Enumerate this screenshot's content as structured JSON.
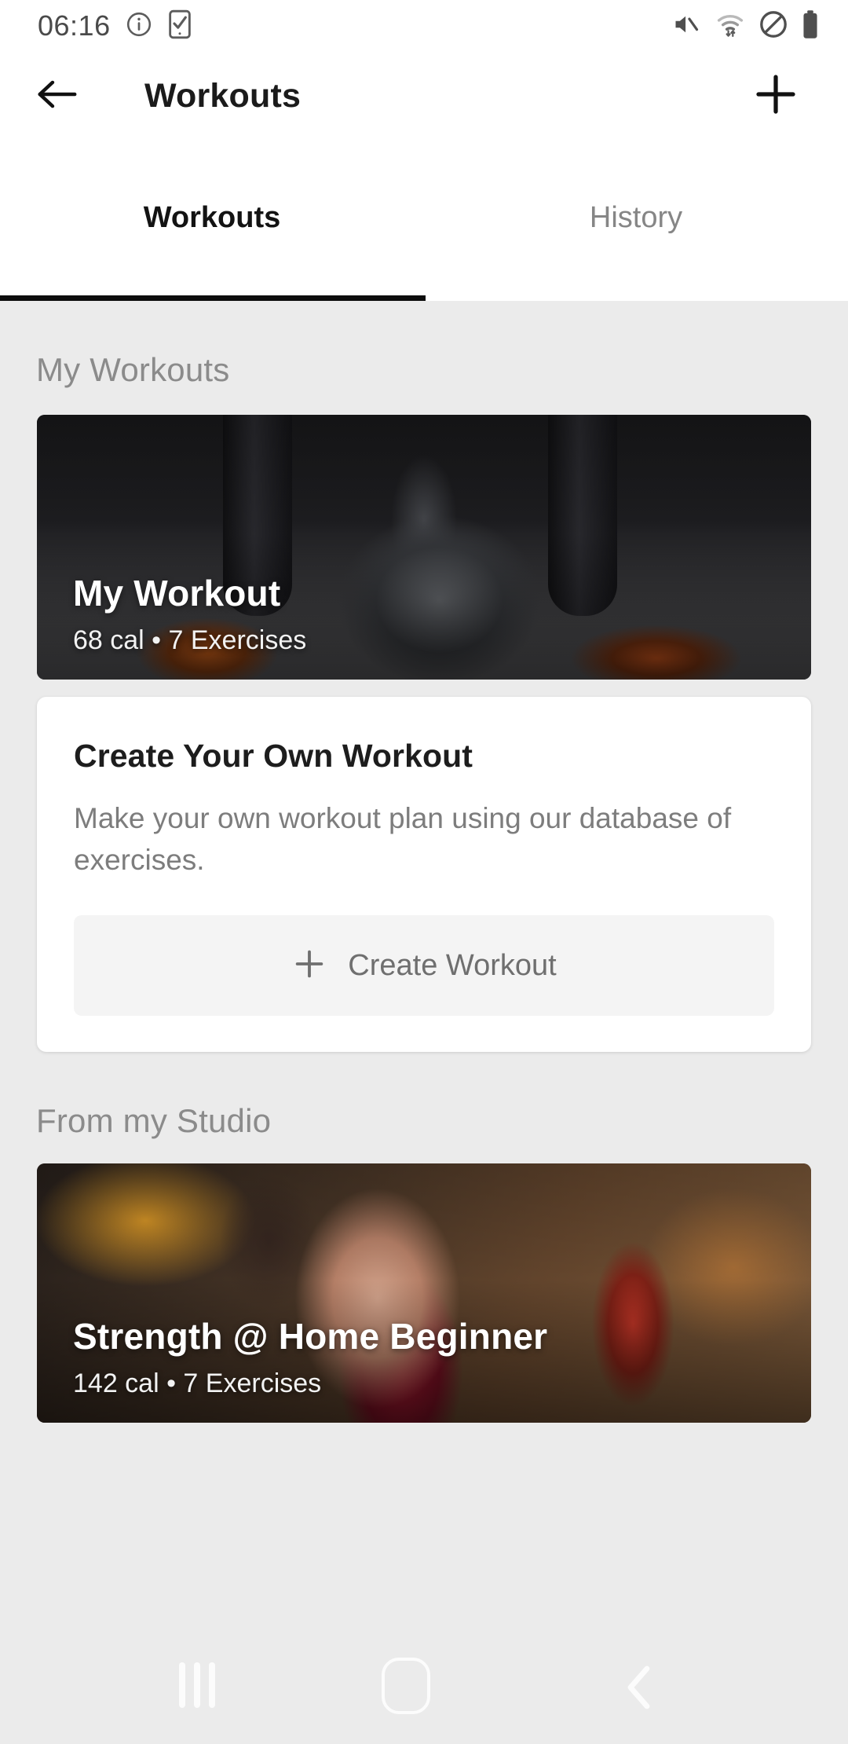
{
  "statusbar": {
    "time": "06:16",
    "left_icons": [
      "info-icon",
      "phone-check-icon"
    ],
    "right_icons": [
      "volume-mute-icon",
      "wifi-icon",
      "do-not-disturb-icon",
      "battery-full-icon"
    ]
  },
  "appbar": {
    "back_icon": "arrow-back-icon",
    "title": "Workouts",
    "add_icon": "plus-icon"
  },
  "tabs": [
    {
      "label": "Workouts",
      "active": true
    },
    {
      "label": "History",
      "active": false
    }
  ],
  "sections": [
    {
      "title": "My Workouts",
      "workout_card": {
        "title": "My Workout",
        "subtitle": "68 cal • 7 Exercises",
        "calories": "68 cal",
        "exercises": "7 Exercises"
      },
      "create_card": {
        "title": "Create Your Own Workout",
        "description": "Make your own workout plan using our database of exercises.",
        "button_label": "Create Workout",
        "button_icon": "plus-icon"
      }
    },
    {
      "title": "From my Studio",
      "workout_card": {
        "title": "Strength @ Home Beginner",
        "subtitle": "142 cal • 7 Exercises",
        "calories": "142 cal",
        "exercises": "7 Exercises"
      }
    }
  ],
  "navbar": {
    "recents_icon": "recents-icon",
    "home_icon": "home-icon",
    "back_icon": "nav-back-icon"
  },
  "colors": {
    "background": "#ebebeb",
    "surface": "#ffffff",
    "text_primary": "#1b1b1b",
    "text_secondary": "#8b8b8b",
    "tab_indicator": "#0d0d0d",
    "button_surface": "#f4f4f4"
  }
}
